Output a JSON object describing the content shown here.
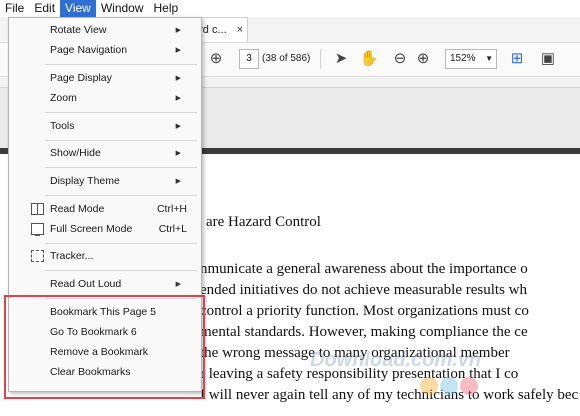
{
  "menubar": {
    "items": [
      "File",
      "Edit",
      "View",
      "Window",
      "Help"
    ],
    "active_index": 2
  },
  "tab": {
    "title": "ard c...",
    "close": "×"
  },
  "toolbar": {
    "page_value": "3",
    "page_count": "(38 of 586)",
    "zoom": "152%",
    "icons": [
      "download-circle-icon",
      "select-arrow-icon",
      "hand-tool-icon",
      "zoom-out-icon",
      "zoom-in-icon",
      "fit-page-icon",
      "page-options-icon"
    ]
  },
  "menu": {
    "items": [
      {
        "label": "Rotate View",
        "submenu": true
      },
      {
        "label": "Page Navigation",
        "submenu": true
      },
      {
        "label": "Page Display",
        "submenu": true
      },
      {
        "label": "Zoom",
        "submenu": true
      },
      {
        "label": "Tools",
        "submenu": true
      },
      {
        "label": "Show/Hide",
        "submenu": true
      },
      {
        "label": "Display Theme",
        "submenu": true
      },
      {
        "label": "Read Mode",
        "shortcut": "Ctrl+H",
        "icon": "read-mode-icon"
      },
      {
        "label": "Full Screen Mode",
        "shortcut": "Ctrl+L",
        "icon": "full-screen-icon"
      },
      {
        "label": "Tracker...",
        "icon": "tracker-icon"
      },
      {
        "label": "Read Out Loud",
        "submenu": true
      },
      {
        "label": "Bookmark This Page 5"
      },
      {
        "label": "Go To Bookmark 6"
      },
      {
        "label": "Remove a Bookmark"
      },
      {
        "label": "Clear Bookmarks"
      }
    ],
    "highlight_color": "#e0434b"
  },
  "document": {
    "heading": "are Hazard Control",
    "lines": [
      "nmunicate a general awareness about the importance o",
      "ended initiatives do not achieve measurable results wh",
      "control a priority function. Most organizations must co",
      "mental standards. However, making compliance the ce",
      "the wrong message to many organizational member",
      "r leaving a safety responsibility presentation that I co",
      "I will never again tell any of my technicians to work safely bec"
    ],
    "watermark": "Download.com.vn"
  },
  "colors": {
    "accent": "#2e6fd1",
    "menu_bg": "#f9f9f9"
  }
}
